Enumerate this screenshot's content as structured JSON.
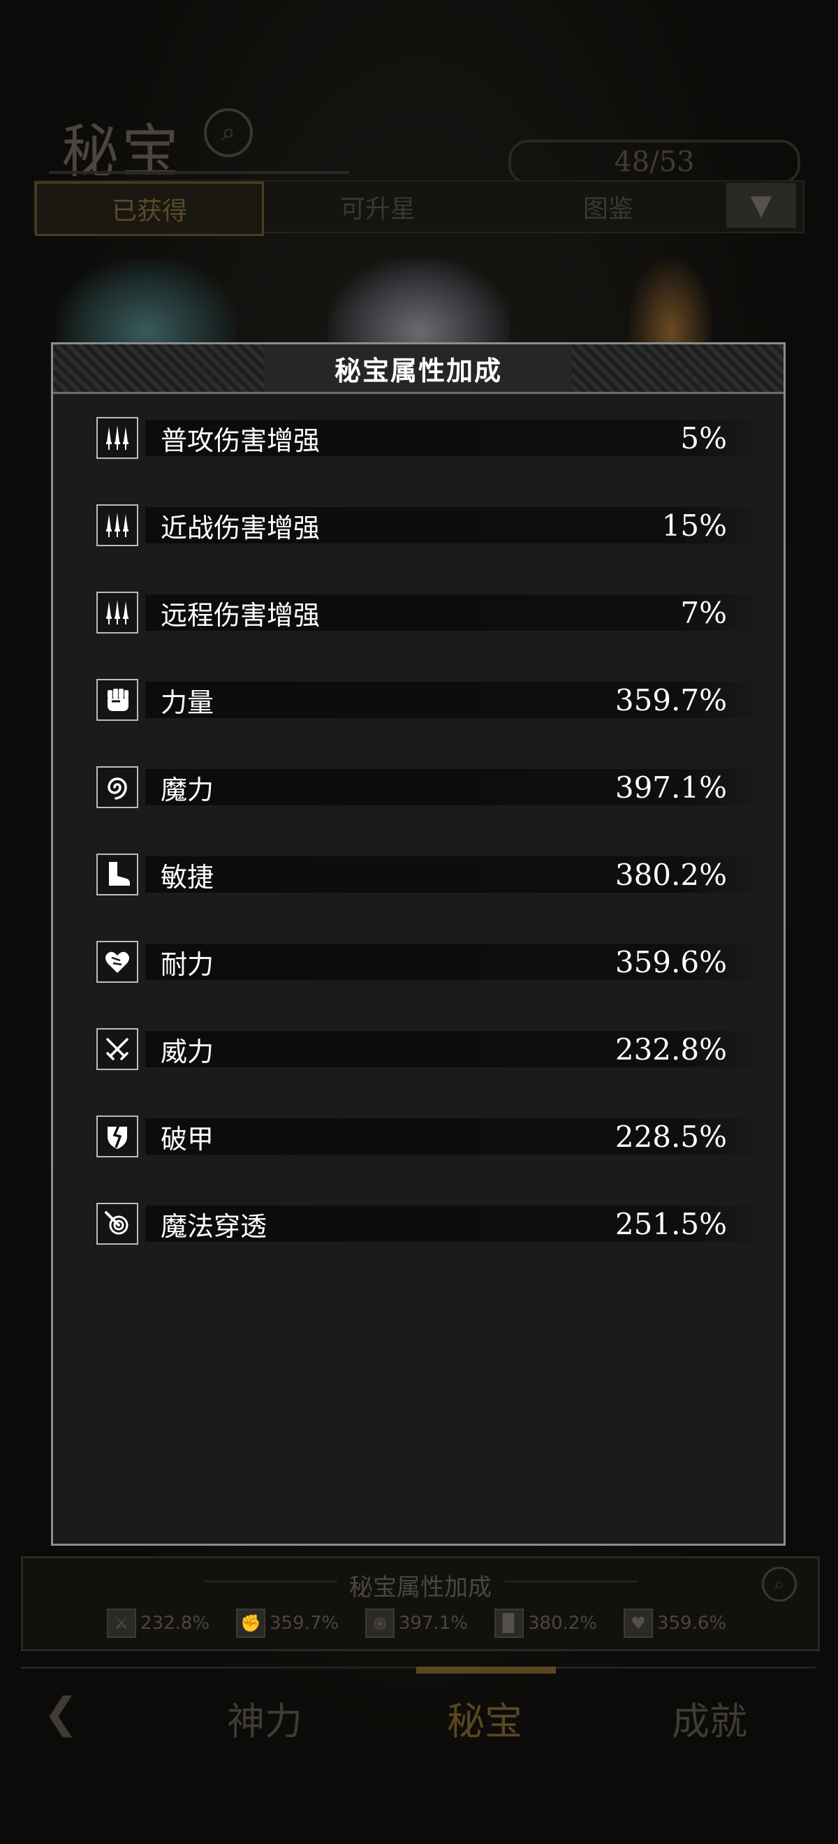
{
  "background": {
    "title": "秘宝",
    "count": "48/53",
    "tabs": [
      "已获得",
      "可升星",
      "图鉴"
    ],
    "summary_title": "秘宝属性加成",
    "summary_stats": [
      "232.8%",
      "359.7%",
      "397.1%",
      "380.2%",
      "359.6%"
    ],
    "nav": [
      "神力",
      "秘宝",
      "成就"
    ]
  },
  "modal": {
    "title": "秘宝属性加成",
    "rows": [
      {
        "icon": "triple-dagger-icon",
        "label": "普攻伤害增强",
        "value": "5%"
      },
      {
        "icon": "triple-dagger-icon",
        "label": "近战伤害增强",
        "value": "15%"
      },
      {
        "icon": "triple-dagger-icon",
        "label": "远程伤害增强",
        "value": "7%"
      },
      {
        "icon": "fist-icon",
        "label": "力量",
        "value": "359.7%"
      },
      {
        "icon": "swirl-icon",
        "label": "魔力",
        "value": "397.1%"
      },
      {
        "icon": "boot-icon",
        "label": "敏捷",
        "value": "380.2%"
      },
      {
        "icon": "heart-icon",
        "label": "耐力",
        "value": "359.6%"
      },
      {
        "icon": "crossed-swords-icon",
        "label": "威力",
        "value": "232.8%"
      },
      {
        "icon": "broken-shield-icon",
        "label": "破甲",
        "value": "228.5%"
      },
      {
        "icon": "magic-pierce-icon",
        "label": "魔法穿透",
        "value": "251.5%"
      }
    ]
  },
  "colors": {
    "accent_gold": "#5a4722",
    "modal_border": "#8d8d8d",
    "modal_bg": "#1b1b1b"
  }
}
